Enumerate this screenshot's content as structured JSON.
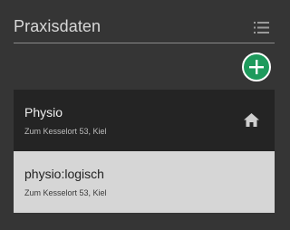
{
  "header": {
    "title": "Praxisdaten",
    "menu_icon": "list-icon"
  },
  "add_button": {
    "icon": "plus-icon",
    "color": "#1e9a5c"
  },
  "practices": [
    {
      "name": "Physio",
      "address": "Zum Kesselort 53, Kiel",
      "selected": true,
      "icon": "home-icon"
    },
    {
      "name": "physio:logisch",
      "address": "Zum Kesselort 53, Kiel",
      "selected": false
    }
  ],
  "colors": {
    "background": "#353535",
    "selected_item": "#242424",
    "normal_item": "#d6d6d6",
    "accent": "#1e9a5c"
  }
}
